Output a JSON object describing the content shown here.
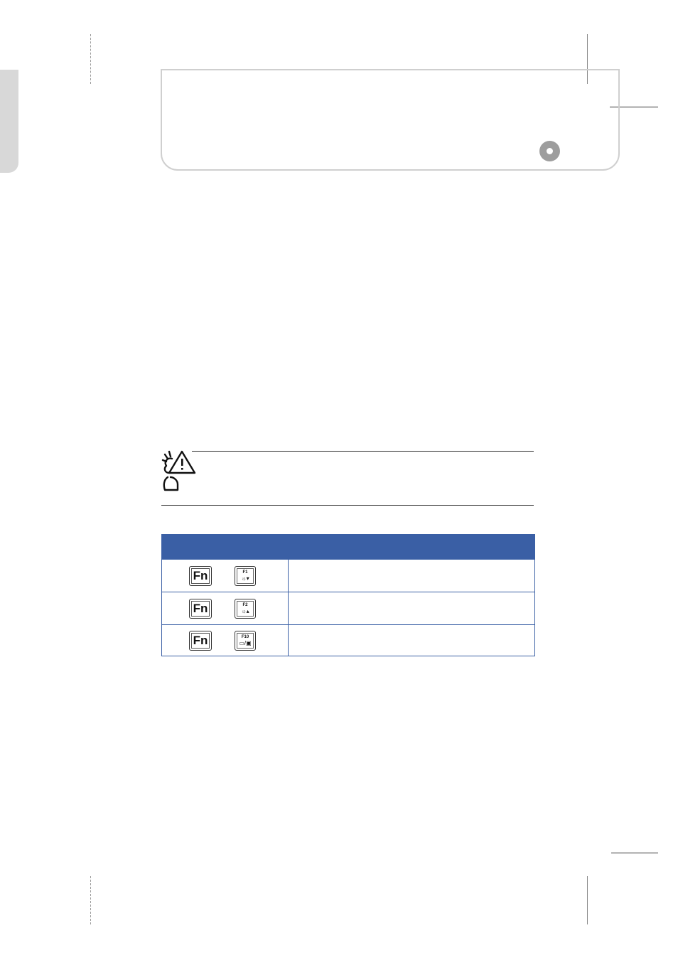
{
  "page": {
    "header_icon": "disc-icon",
    "note_icon": "caution-person-icon"
  },
  "hotkey_table": {
    "rows": [
      {
        "fn_key": "Fn",
        "f_key": "F1",
        "f_symbol": "☼▾",
        "f_icon": "brightness-down-icon"
      },
      {
        "fn_key": "Fn",
        "f_key": "F2",
        "f_symbol": "☼▴",
        "f_icon": "brightness-up-icon"
      },
      {
        "fn_key": "Fn",
        "f_key": "F10",
        "f_symbol": "▭/▣",
        "f_icon": "display-toggle-icon"
      }
    ]
  },
  "colors": {
    "table_accent": "#3a5fa5",
    "header_border": "#cfcfcf",
    "side_tab": "#d8d8d8"
  }
}
